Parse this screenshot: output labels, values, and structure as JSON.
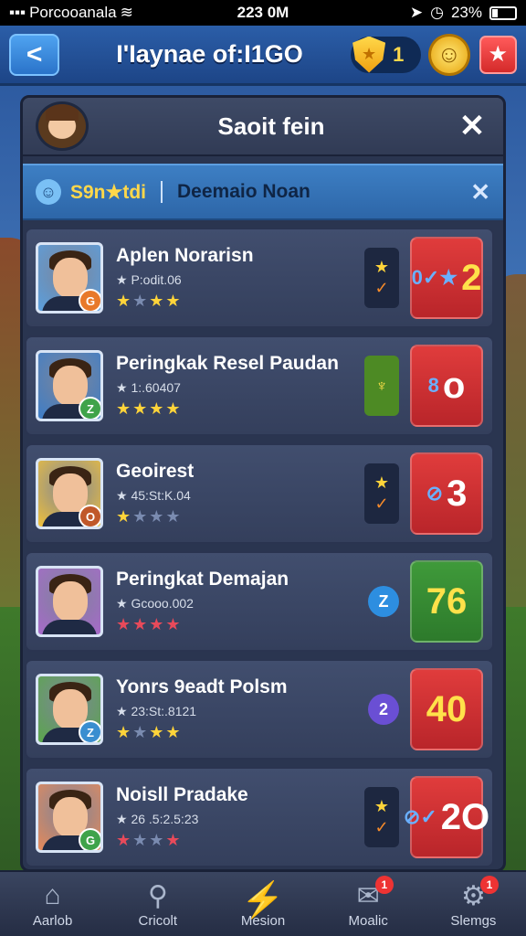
{
  "status_bar": {
    "carrier": "Porcooanala",
    "time": "223 0M",
    "battery": "23%"
  },
  "top_bar": {
    "back_label": "<",
    "title": "I'Iaynae of:I1GO",
    "level": "1"
  },
  "modal": {
    "title": "Saoit fein",
    "close_label": "✕",
    "search_tab": {
      "tab_a": "S9n★tdi",
      "tab_b": "Deemaio Noan",
      "close_label": "✕"
    }
  },
  "players": [
    {
      "name": "Aplen Norarisn",
      "sub": "P:odit.06",
      "stars": [
        "on",
        "off",
        "on",
        "on"
      ],
      "badge": "G",
      "badge_color": "#e8792a",
      "bg": "#5aa0e0",
      "mid": [
        "★",
        "✓"
      ],
      "score": "2",
      "score_prefix": "0✓★",
      "score_style": "red"
    },
    {
      "name": "Peringkak Resel Paudan",
      "sub": "1:.60407",
      "stars": [
        "on",
        "on",
        "on",
        "on"
      ],
      "badge": "Z",
      "badge_color": "#3fa34a",
      "bg": "#3d7ec9",
      "mid": [
        "♆"
      ],
      "score": "o",
      "score_prefix": "8",
      "score_style": "red"
    },
    {
      "name": "Geoirest",
      "sub": "45:St:K.04",
      "stars": [
        "on",
        "off",
        "off",
        "off"
      ],
      "badge": "O",
      "badge_color": "#c0582a",
      "bg": "#f2c23a",
      "mid": [
        "★",
        "✓"
      ],
      "score": "3",
      "score_prefix": "⊘",
      "score_style": "red"
    },
    {
      "name": "Peringkat Demajan",
      "sub": "Gcooo.002",
      "stars": [
        "red",
        "red",
        "red",
        "red"
      ],
      "badge": "",
      "badge_color": "",
      "bg": "#a86acb",
      "mid": [
        "Z"
      ],
      "score": "76",
      "score_prefix": "",
      "score_style": "green"
    },
    {
      "name": "Yonrs 9eadt Polsm",
      "sub": "23:St:.8121",
      "stars": [
        "on",
        "off",
        "on",
        "on"
      ],
      "badge": "Z",
      "badge_color": "#3a8ed0",
      "bg": "#5aa84a",
      "mid": [
        "2"
      ],
      "score": "40",
      "score_prefix": "",
      "score_style": "red"
    },
    {
      "name": "Noisll Pradake",
      "sub": "26 .5:2.5:23",
      "stars": [
        "red",
        "off",
        "off",
        "red"
      ],
      "badge": "G",
      "badge_color": "#3fa34a",
      "bg": "#e88a5a",
      "mid": [
        "★",
        "✓"
      ],
      "score": "2O",
      "score_prefix": "⊘✓",
      "score_style": "red"
    }
  ],
  "bottom_nav": [
    {
      "label": "Aarlob",
      "icon": "home-icon",
      "glyph": "⌂",
      "badge": ""
    },
    {
      "label": "Cricolt",
      "icon": "search-icon",
      "glyph": "⚲",
      "badge": ""
    },
    {
      "label": "Mesion",
      "icon": "lightning-icon",
      "glyph": "⚡",
      "badge": "",
      "active": true
    },
    {
      "label": "Moalic",
      "icon": "mail-icon",
      "glyph": "✉",
      "badge": "1"
    },
    {
      "label": "Slemgs",
      "icon": "settings-icon",
      "glyph": "⚙",
      "badge": "1"
    }
  ],
  "colors": {
    "accent": "#2b5ea8",
    "score_red": "#e03c3c",
    "score_green": "#3f9a3a",
    "star": "#ffd43a"
  }
}
